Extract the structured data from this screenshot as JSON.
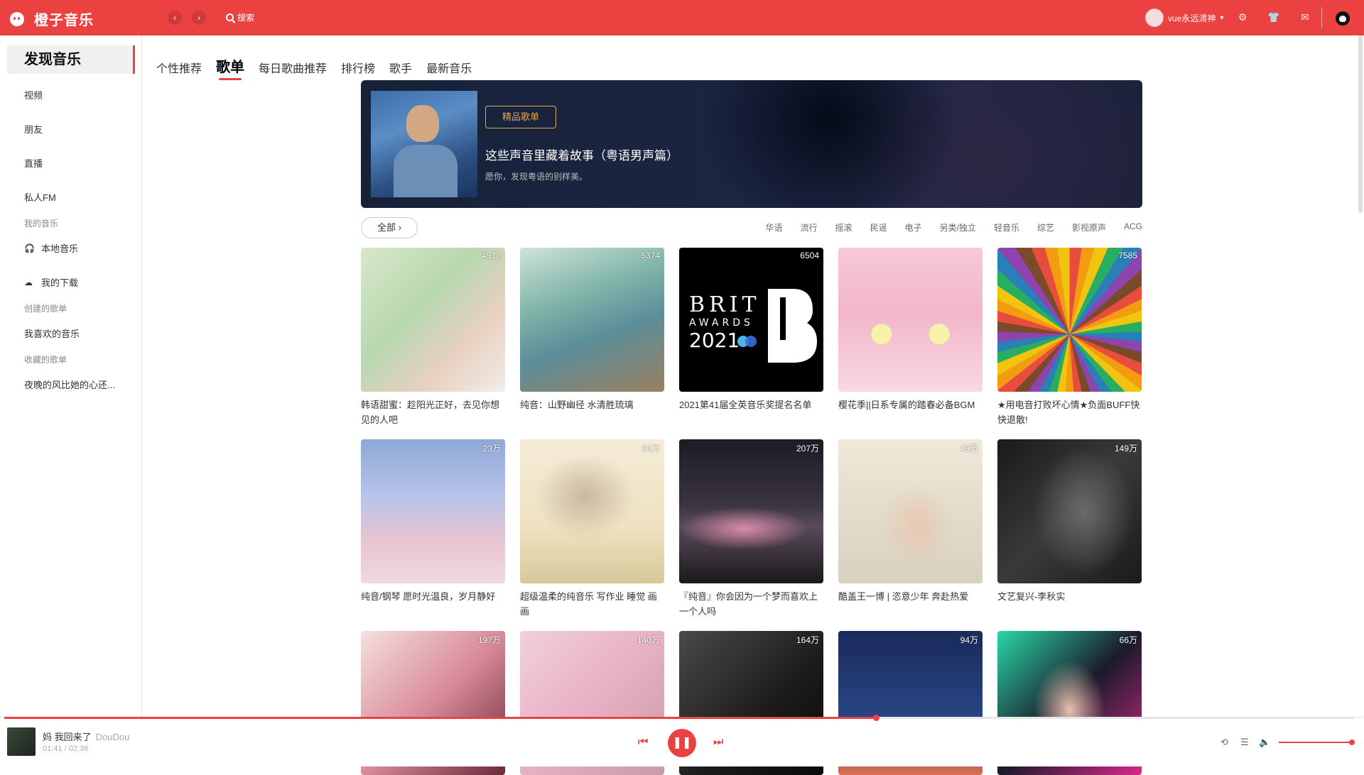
{
  "app": {
    "name": "橙子音乐"
  },
  "header": {
    "back": "‹",
    "forward": "›",
    "search_label": "搜索",
    "user_name": "vue永远滴神",
    "caret": "▾",
    "settings_icon": "⚙",
    "skin_icon": "👕",
    "mail_icon": "✉"
  },
  "sidebar": {
    "active": "发现音乐",
    "items": [
      "视频",
      "朋友",
      "直播",
      "私人FM"
    ],
    "my_music_label": "我的音乐",
    "local_music": "本地音乐",
    "downloads": "我的下载",
    "created_label": "创建的歌单",
    "liked": "我喜欢的音乐",
    "collected_label": "收藏的歌单",
    "collected_item": "夜晚的风比她的心还..."
  },
  "tabs": [
    "个性推荐",
    "歌单",
    "每日歌曲推荐",
    "排行榜",
    "歌手",
    "最新音乐"
  ],
  "banner": {
    "tag": "精品歌单",
    "title": "这些声音里藏着故事（粤语男声篇）",
    "subtitle": "愿你，发现粤语的别样美。"
  },
  "filter": {
    "all": "全部 ›",
    "categories": [
      "华语",
      "流行",
      "摇滚",
      "民谣",
      "电子",
      "另类/独立",
      "轻音乐",
      "综艺",
      "影视原声",
      "ACG"
    ]
  },
  "playlists": [
    {
      "count": "4912",
      "title": "韩语甜蜜：趁阳光正好，去见你想见的人吧"
    },
    {
      "count": "5374",
      "title": "纯音：山野幽径 水清胜琉璃"
    },
    {
      "count": "6504",
      "title": "2021第41届全英音乐奖提名名单"
    },
    {
      "count": "",
      "title": "樱花季||日系专属的踏春必备BGM"
    },
    {
      "count": "7585",
      "title": "★用电音打败坏心情★负面BUFF快快退散!"
    },
    {
      "count": "23万",
      "title": "纯音/钢琴 愿时光温良，岁月静好"
    },
    {
      "count": "96万",
      "title": "超级温柔的纯音乐 写作业 睡觉 画画"
    },
    {
      "count": "207万",
      "title": "『纯音』你会因为一个梦而喜欢上一个人吗"
    },
    {
      "count": "49万",
      "title": "酷盖王一博 | 恣意少年 奔赴热爱"
    },
    {
      "count": "149万",
      "title": "文艺复兴-李秋实"
    },
    {
      "count": "197万",
      "title": ""
    },
    {
      "count": "140万",
      "title": ""
    },
    {
      "count": "164万",
      "title": ""
    },
    {
      "count": "94万",
      "title": ""
    },
    {
      "count": "66万",
      "title": ""
    }
  ],
  "player": {
    "song": "妈 我回来了",
    "artist": "DouDou",
    "time": "01:41 / 02:36",
    "progress": 0.646,
    "volume": 1.0,
    "prev": "⏮",
    "pause": "❚❚",
    "next": "⏭",
    "loop_icon": "⟲",
    "list_icon": "☰",
    "volume_icon": "🔈"
  },
  "colors": {
    "accent": "#ec4141"
  }
}
